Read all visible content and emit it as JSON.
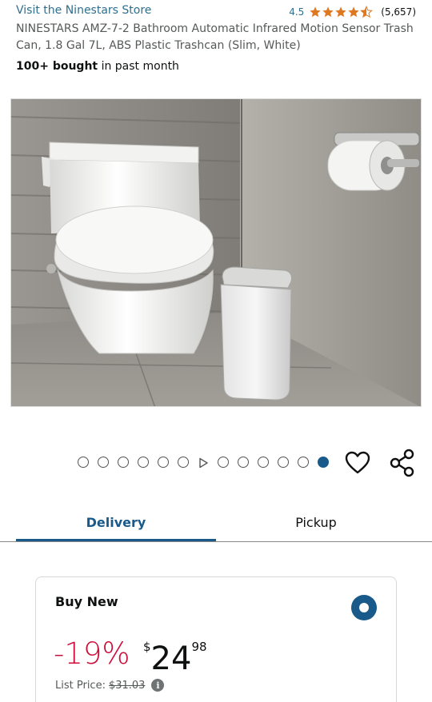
{
  "header": {
    "store_link": "Visit the Ninestars Store",
    "rating_value": "4.5",
    "rating_stars": 4.5,
    "rating_count": "(5,657)",
    "title": "NINESTARS AMZ-7-2 Bathroom Automatic Infrared Motion Sensor Trash Can, 1.8 Gal 7L, ABS Plastic Trashcan (Slim, White)",
    "bought_bold": "100+ bought",
    "bought_rest": " in past month"
  },
  "gallery": {
    "dots_before_video": 6,
    "dots_after_video": 6,
    "active_dot_index": 12
  },
  "tabs": [
    {
      "label": "Delivery",
      "active": true
    },
    {
      "label": "Pickup",
      "active": false
    }
  ],
  "buy_new": {
    "label": "Buy New",
    "discount": "-19%",
    "price_currency": "$",
    "price_whole": "24",
    "price_fraction": "98",
    "list_price_label": "List Price:",
    "list_price_value": "$31.03",
    "info_symbol": "i"
  },
  "colors": {
    "link": "#2f6f8f",
    "star": "#de7921",
    "accent": "#1a5a8a",
    "discount": "#cc0c39"
  }
}
